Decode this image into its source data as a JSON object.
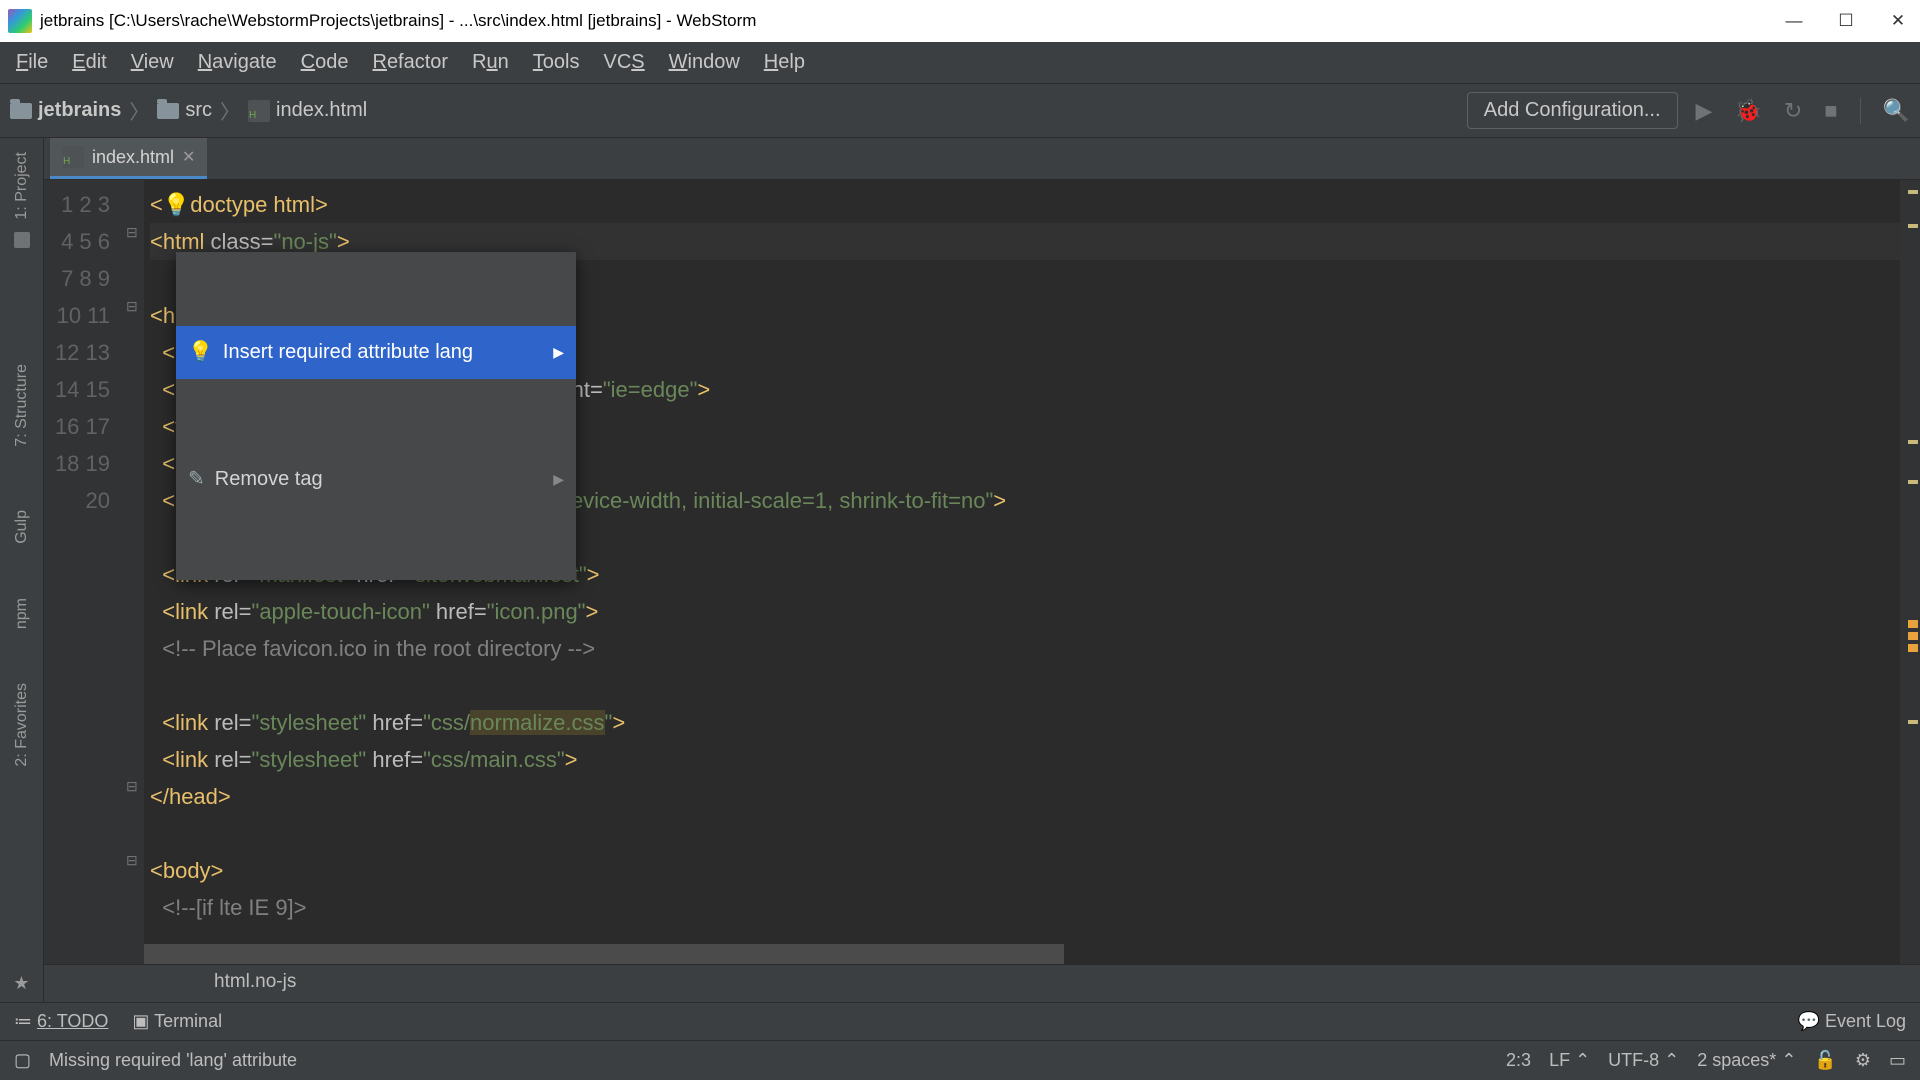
{
  "window": {
    "title": "jetbrains [C:\\Users\\rache\\WebstormProjects\\jetbrains] - ...\\src\\index.html [jetbrains] - WebStorm"
  },
  "menu": [
    "File",
    "Edit",
    "View",
    "Navigate",
    "Code",
    "Refactor",
    "Run",
    "Tools",
    "VCS",
    "Window",
    "Help"
  ],
  "breadcrumb": {
    "project": "jetbrains",
    "folder": "src",
    "file": "index.html"
  },
  "toolbar": {
    "config": "Add Configuration..."
  },
  "tabs": [
    {
      "label": "index.html"
    }
  ],
  "leftTools": [
    "1: Project",
    "7: Structure",
    "Gulp",
    "npm",
    "2: Favorites"
  ],
  "popup": {
    "item1": "Insert required attribute lang",
    "item2": "Remove tag"
  },
  "code": {
    "lines": [
      {
        "n": "1",
        "kind": "doctype",
        "raw": "<!doctype html>"
      },
      {
        "n": "2",
        "kind": "html-open"
      },
      {
        "n": "3",
        "kind": "blank"
      },
      {
        "n": "4",
        "kind": "head-open"
      },
      {
        "n": "5",
        "kind": "meta-charset"
      },
      {
        "n": "6",
        "kind": "meta-compat"
      },
      {
        "n": "7",
        "kind": "title"
      },
      {
        "n": "8",
        "kind": "meta-desc"
      },
      {
        "n": "9",
        "kind": "meta-viewport"
      },
      {
        "n": "10",
        "kind": "blank"
      },
      {
        "n": "11",
        "kind": "link-manifest"
      },
      {
        "n": "12",
        "kind": "link-icon"
      },
      {
        "n": "13",
        "kind": "comment-favicon"
      },
      {
        "n": "14",
        "kind": "blank"
      },
      {
        "n": "15",
        "kind": "link-normalize"
      },
      {
        "n": "16",
        "kind": "link-main"
      },
      {
        "n": "17",
        "kind": "head-close"
      },
      {
        "n": "18",
        "kind": "blank"
      },
      {
        "n": "19",
        "kind": "body-open"
      },
      {
        "n": "20",
        "kind": "ie-comment"
      }
    ]
  },
  "editorBreadcrumb": "html.no-js",
  "bottomTools": {
    "todo": "6: TODO",
    "terminal": "Terminal",
    "eventlog": "Event Log"
  },
  "status": {
    "message": "Missing required 'lang' attribute",
    "pos": "2:3",
    "lineend": "LF",
    "encoding": "UTF-8",
    "indent": "2 spaces*"
  }
}
